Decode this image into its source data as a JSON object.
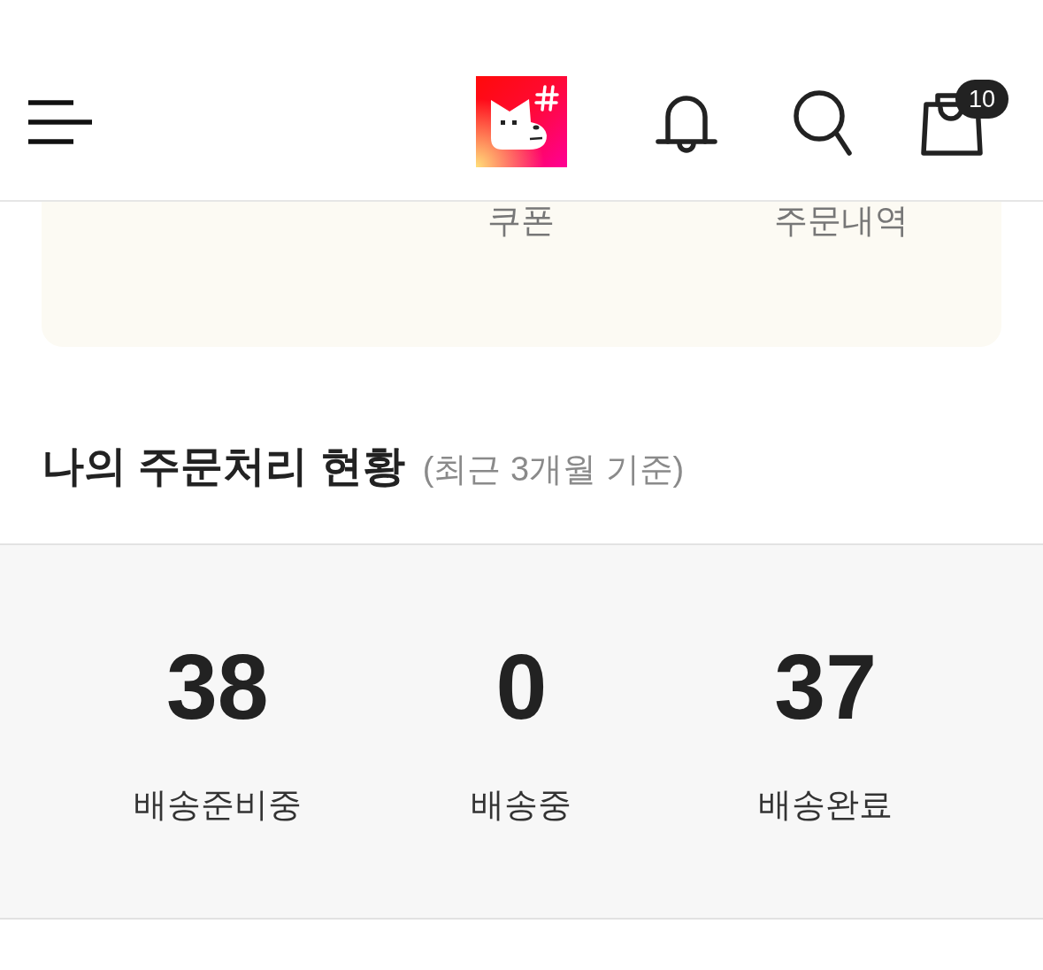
{
  "header": {
    "cart_badge": "10"
  },
  "shortcut_card": {
    "items": [
      {
        "label": "쿠폰"
      },
      {
        "label": "주문내역"
      }
    ]
  },
  "order_status": {
    "title": "나의 주문처리 현황",
    "subtitle": "(최근 3개월 기준)",
    "stats": [
      {
        "count": "38",
        "label": "배송준비중"
      },
      {
        "count": "0",
        "label": "배송중"
      },
      {
        "count": "37",
        "label": "배송완료"
      }
    ]
  }
}
